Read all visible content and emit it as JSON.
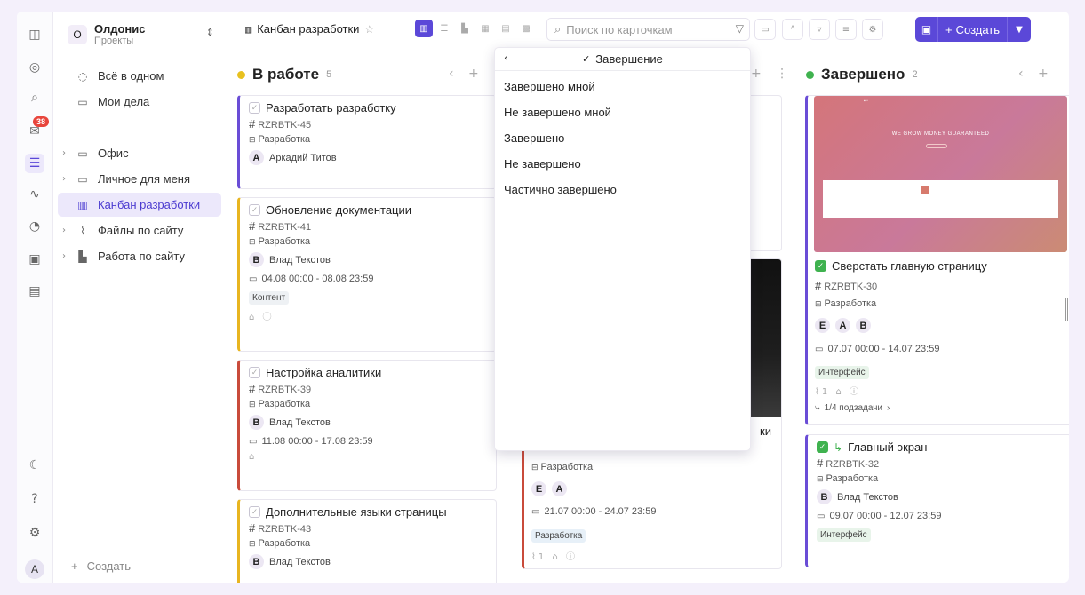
{
  "workspace": {
    "badge": "О",
    "name": "Олдонис",
    "sub": "Проекты"
  },
  "rail": {
    "notif_count": "38",
    "user_initial": "A"
  },
  "sidebar": {
    "items": [
      {
        "label": "Всё в одном"
      },
      {
        "label": "Мои дела"
      },
      {
        "label": "Офис"
      },
      {
        "label": "Личное для меня"
      },
      {
        "label": "Канбан разработки"
      },
      {
        "label": "Файлы по сайту"
      },
      {
        "label": "Работа по сайту"
      }
    ],
    "create_label": "Создать"
  },
  "topbar": {
    "board_title": "Канбан разработки",
    "search_placeholder": "Поиск по карточкам",
    "create_label": "Создать"
  },
  "columns": [
    {
      "title": "В работе",
      "count": "5",
      "color": "#e8c11f"
    },
    {
      "title": "Завершено",
      "count": "2",
      "color": "#3fb24f"
    }
  ],
  "cards_work": [
    {
      "title": "Разработать разработку",
      "key": "RZRBTK-45",
      "group": "Разработка",
      "avatar": "A",
      "user": "Аркадий Титов",
      "accent": "#6a4dd6"
    },
    {
      "title": "Обновление документации",
      "key": "RZRBTK-41",
      "group": "Разработка",
      "avatar": "B",
      "user": "Влад Текстов",
      "date": "04.08 00:00 - 08.08 23:59",
      "tag": "Контент",
      "accent": "#e8b520"
    },
    {
      "title": "Настройка аналитики",
      "key": "RZRBTK-39",
      "group": "Разработка",
      "avatar": "B",
      "user": "Влад Текстов",
      "date": "11.08 00:00 - 17.08 23:59",
      "accent": "#c94b3b"
    },
    {
      "title": "Дополнительные языки страницы",
      "key": "RZRBTK-43",
      "group": "Разработка",
      "avatar": "B",
      "user": "Влад Текстов",
      "accent": "#e8b520"
    }
  ],
  "card_mid": {
    "title_tail": "ки",
    "group": "Разработка",
    "avatars": [
      "E",
      "A"
    ],
    "date": "21.07 00:00 - 24.07 23:59",
    "tag": "Разработка",
    "attach": "1"
  },
  "cards_done": [
    {
      "title": "Сверстать главную страницу",
      "key": "RZRBTK-30",
      "group": "Разработка",
      "avatars": [
        "E",
        "A",
        "B"
      ],
      "date": "07.07 00:00 - 14.07 23:59",
      "tag": "Интерфейс",
      "attach": "1",
      "subtasks": "1/4 подзадачи",
      "accent": "#6a4dd6"
    },
    {
      "title": "Главный экран",
      "key": "RZRBTK-32",
      "group": "Разработка",
      "avatar": "B",
      "user": "Влад Текстов",
      "date": "09.07 00:00 - 12.07 23:59",
      "tag": "Интерфейс",
      "accent": "#6a4dd6"
    }
  ],
  "cover": {
    "headline": "WE GROW MONEY GUARANTEED"
  },
  "dropdown": {
    "title": "Завершение",
    "options": [
      {
        "label": "Завершено мной"
      },
      {
        "label": "Не завершено мной"
      },
      {
        "label": "Завершено"
      },
      {
        "label": "Не завершено"
      },
      {
        "label": "Частично завершено"
      }
    ]
  }
}
